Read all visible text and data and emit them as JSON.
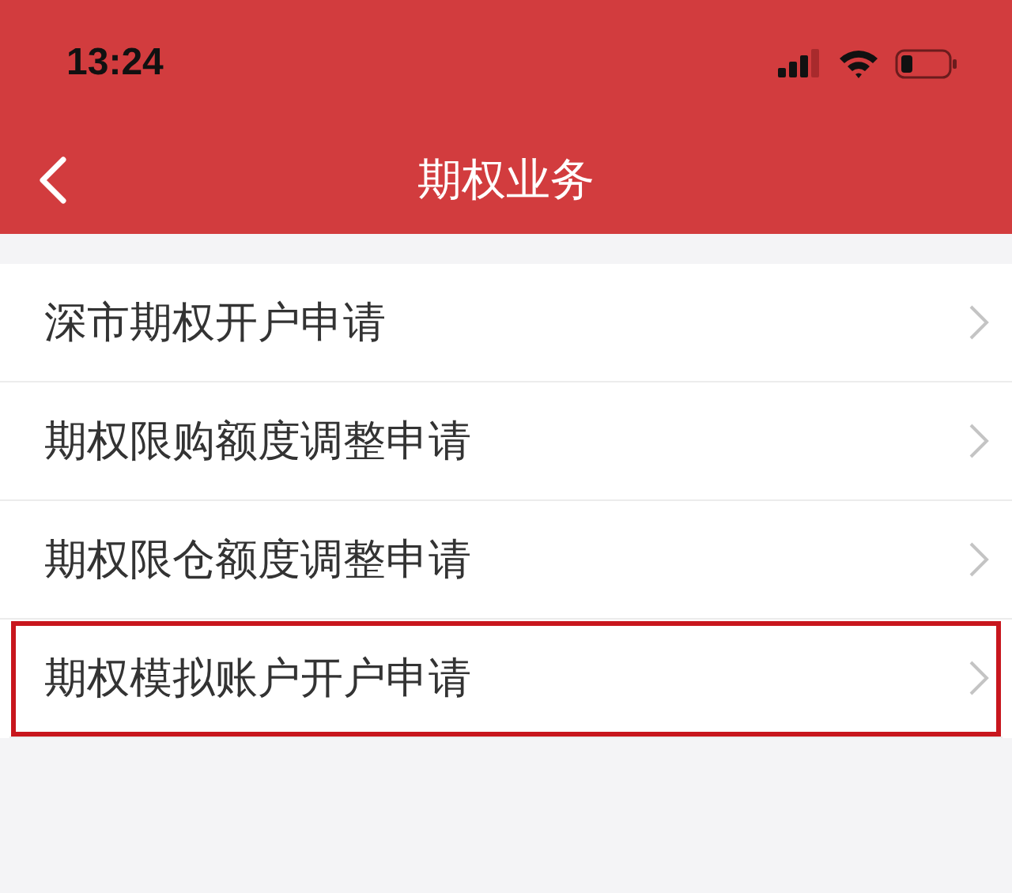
{
  "status_bar": {
    "time": "13:24"
  },
  "nav_bar": {
    "title": "期权业务"
  },
  "menu": {
    "items": [
      {
        "label": "深市期权开户申请",
        "highlighted": false
      },
      {
        "label": "期权限购额度调整申请",
        "highlighted": false
      },
      {
        "label": "期权限仓额度调整申请",
        "highlighted": false
      },
      {
        "label": "期权模拟账户开户申请",
        "highlighted": true
      }
    ]
  }
}
